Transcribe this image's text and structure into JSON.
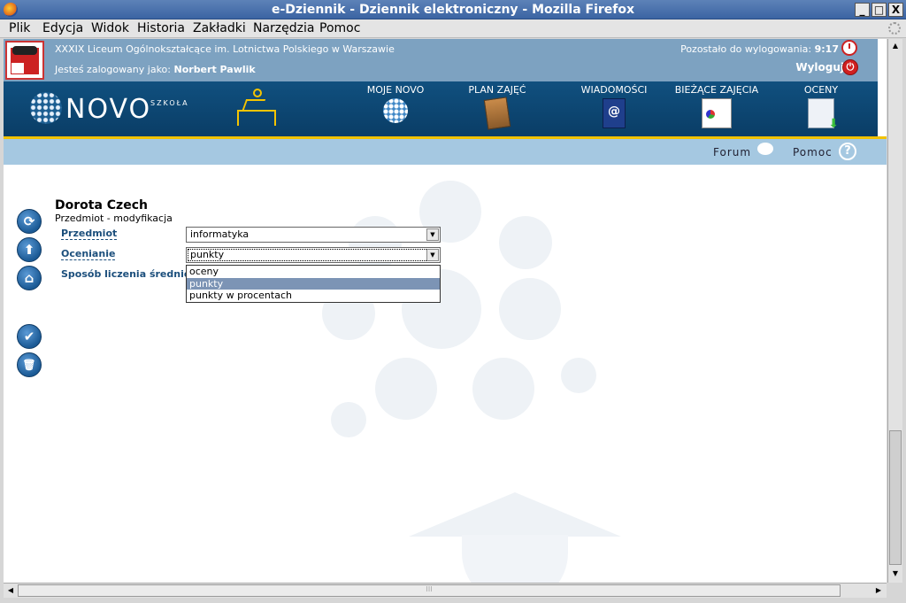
{
  "window": {
    "title": "e-Dziennik - Dziennik elektroniczny - Mozilla Firefox",
    "controls": {
      "minimize": "_",
      "maximize": "□",
      "close": "X"
    }
  },
  "menubar": [
    "Plik",
    "Edycja",
    "Widok",
    "Historia",
    "Zakładki",
    "Narzędzia",
    "Pomoc"
  ],
  "header": {
    "school": "XXXIX Liceum Ogólnokształcące im. Lotnictwa Polskiego w Warszawie",
    "logged_prefix": "Jesteś zalogowany jako:",
    "user": "Norbert Pawlik",
    "remaining_prefix": "Pozostało do wylogowania:",
    "remaining_time": "9:17",
    "logout": "Wyloguj"
  },
  "logo": {
    "word": "NOVO",
    "sub": "SZKOŁA"
  },
  "nav": [
    {
      "label": "MOJE NOVO",
      "icon": "globe-icon"
    },
    {
      "label": "PLAN ZAJĘĆ",
      "icon": "plan-book-icon"
    },
    {
      "label": "WIADOMOŚCI",
      "icon": "message-icon"
    },
    {
      "label": "BIEŻĄCE ZAJĘCIA",
      "icon": "current-lessons-icon"
    },
    {
      "label": "OCENY",
      "icon": "grades-icon"
    }
  ],
  "subbar": {
    "forum": "Forum",
    "help": "Pomoc",
    "help_glyph": "?"
  },
  "form": {
    "name": "Dorota Czech",
    "subtitle": "Przedmiot - modyfikacja",
    "subject_label": "Przedmiot",
    "subject_value": "informatyka",
    "grading_label": "Ocenianie",
    "grading_value": "punkty",
    "average_label": "Sposób liczenia średniej",
    "grading_options": [
      "oceny",
      "punkty",
      "punkty w procentach"
    ],
    "selected_option": "punkty"
  },
  "side_actions": [
    {
      "name": "refresh-icon",
      "glyph": "⟳"
    },
    {
      "name": "up-arrow-icon",
      "glyph": "⬆"
    },
    {
      "name": "home-icon",
      "glyph": "⌂"
    },
    {
      "name": "check-save-icon",
      "glyph": "✔"
    },
    {
      "name": "trash-icon",
      "glyph": "🗑"
    }
  ],
  "colors": {
    "header": "#7da2c1",
    "navbar": "#10507f",
    "accent": "#f2c200",
    "subbar": "#a5c8e1",
    "selected": "#7c94b5"
  }
}
